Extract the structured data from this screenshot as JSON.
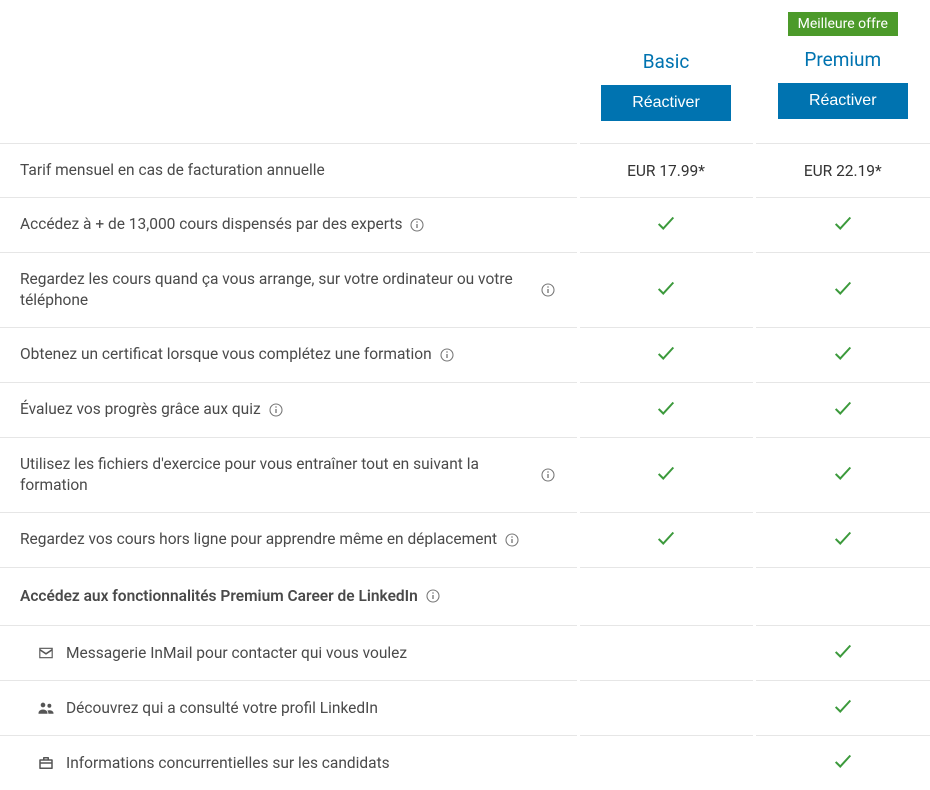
{
  "badge": "Meilleure offre",
  "plans": {
    "basic": {
      "name": "Basic",
      "cta": "Réactiver",
      "price": "EUR 17.99*"
    },
    "premium": {
      "name": "Premium",
      "cta": "Réactiver",
      "price": "EUR 22.19*"
    }
  },
  "price_row_label": "Tarif mensuel en cas de facturation annuelle",
  "features": [
    {
      "label": "Accédez à + de 13,000 cours dispensés par des experts",
      "info": true,
      "basic": true,
      "premium": true
    },
    {
      "label": "Regardez les cours quand ça vous arrange, sur votre ordinateur ou votre téléphone",
      "info": true,
      "basic": true,
      "premium": true
    },
    {
      "label": "Obtenez un certificat lorsque vous complétez une formation",
      "info": true,
      "basic": true,
      "premium": true
    },
    {
      "label": "Évaluez vos progrès grâce aux quiz",
      "info": true,
      "basic": true,
      "premium": true
    },
    {
      "label": "Utilisez les fichiers d'exercice pour vous entraîner tout en suivant la formation",
      "info": true,
      "basic": true,
      "premium": true
    },
    {
      "label": "Regardez vos cours hors ligne pour apprendre même en déplacement",
      "info": true,
      "basic": true,
      "premium": true
    }
  ],
  "section_header": "Accédez aux fonctionnalités Premium Career de LinkedIn",
  "sub_features": [
    {
      "icon": "mail",
      "label": "Messagerie InMail pour contacter qui vous voulez",
      "basic": false,
      "premium": true
    },
    {
      "icon": "people",
      "label": "Découvrez qui a consulté votre profil LinkedIn",
      "basic": false,
      "premium": true
    },
    {
      "icon": "briefcase",
      "label": "Informations concurrentielles sur les candidats",
      "basic": false,
      "premium": true
    }
  ]
}
